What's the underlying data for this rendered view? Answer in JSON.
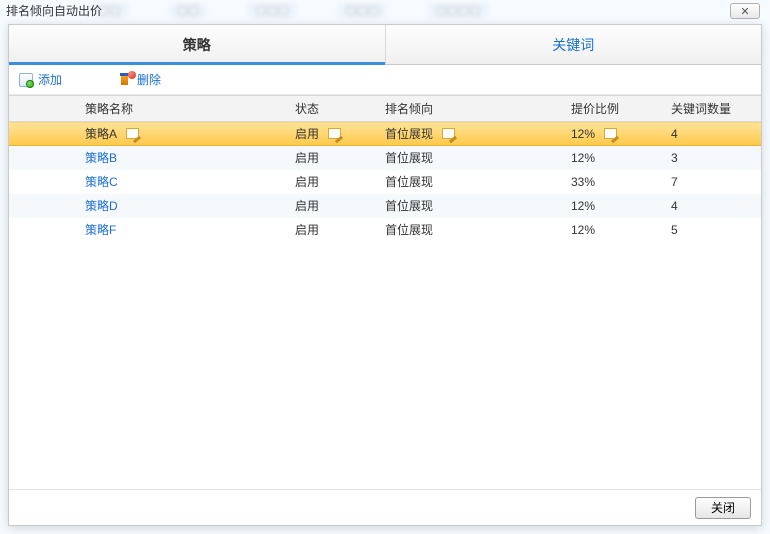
{
  "window": {
    "title": "排名倾向自动出价",
    "close_glyph": "✕"
  },
  "tabs": [
    {
      "label": "策略",
      "active": true
    },
    {
      "label": "关键词",
      "active": false
    }
  ],
  "toolbar": {
    "add_label": "添加",
    "del_label": "删除"
  },
  "table": {
    "columns": {
      "name": "策略名称",
      "status": "状态",
      "rank": "排名倾向",
      "ratio": "提价比例",
      "kw": "关键词数量"
    },
    "rows": [
      {
        "name": "策略A",
        "status": "启用",
        "rank": "首位展现",
        "ratio": "12%",
        "kw": "4",
        "selected": true,
        "editable": true
      },
      {
        "name": "策略B",
        "status": "启用",
        "rank": "首位展现",
        "ratio": "12%",
        "kw": "3",
        "selected": false,
        "editable": false
      },
      {
        "name": "策略C",
        "status": "启用",
        "rank": "首位展现",
        "ratio": "33%",
        "kw": "7",
        "selected": false,
        "editable": false
      },
      {
        "name": "策略D",
        "status": "启用",
        "rank": "首位展现",
        "ratio": "12%",
        "kw": "4",
        "selected": false,
        "editable": false
      },
      {
        "name": "策略F",
        "status": "启用",
        "rank": "首位展现",
        "ratio": "12%",
        "kw": "5",
        "selected": false,
        "editable": false
      }
    ]
  },
  "footer": {
    "close_label": "关闭"
  }
}
